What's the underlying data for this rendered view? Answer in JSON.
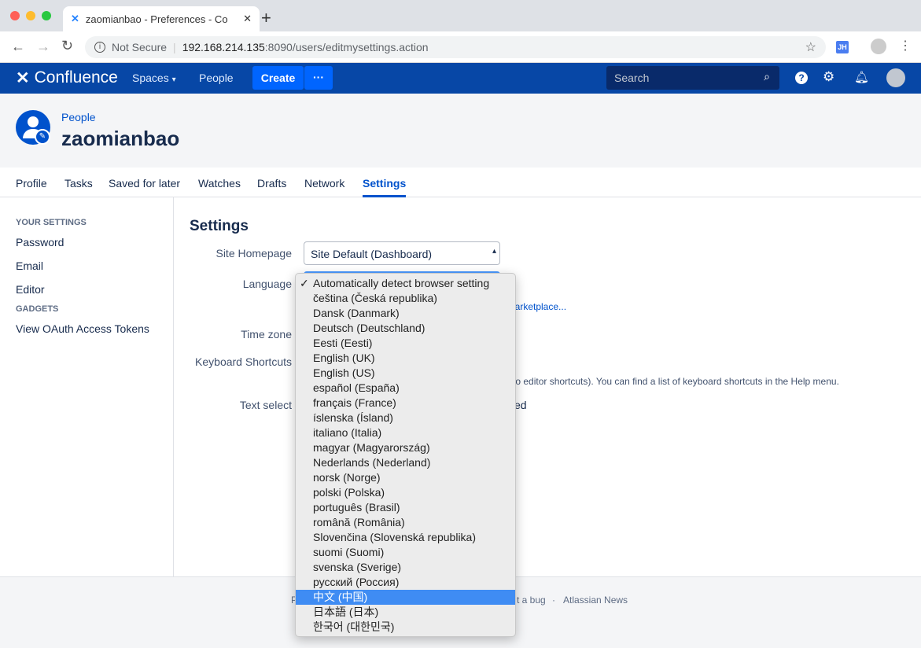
{
  "browser": {
    "tab_title": "zaomianbao - Preferences - Co",
    "security": "Not Secure",
    "url_host": "192.168.214.135",
    "url_rest": ":8090/users/editmysettings.action",
    "ext_badge": "JH"
  },
  "nav": {
    "logo": "Confluence",
    "spaces": "Spaces",
    "people": "People",
    "create": "Create",
    "more": "···",
    "search_placeholder": "Search"
  },
  "header": {
    "breadcrumb": "People",
    "username": "zaomianbao"
  },
  "tabs": [
    "Profile",
    "Tasks",
    "Saved for later",
    "Watches",
    "Drafts",
    "Network",
    "Settings"
  ],
  "active_tab": "Settings",
  "sidebar": {
    "your_settings": "YOUR SETTINGS",
    "items": [
      "Password",
      "Email",
      "Editor"
    ],
    "gadgets": "GADGETS",
    "gadget_items": [
      "View OAuth Access Tokens"
    ]
  },
  "settings": {
    "title": "Settings",
    "site_homepage_label": "Site Homepage",
    "site_homepage_value": "Site Default (Dashboard)",
    "language_label": "Language",
    "time_zone_label": "Time zone",
    "keyboard_label": "Keyboard Shortcuts",
    "text_select_label": "Text select",
    "marketplace_fragment": "larketplace...",
    "keyboard_fragment": "to editor shortcuts). You can find a list of keyboard shortcuts in the Help menu.",
    "text_select_fragment": "ed"
  },
  "language_options": [
    "Automatically detect browser setting",
    "čeština (Česká republika)",
    "Dansk (Danmark)",
    "Deutsch (Deutschland)",
    "Eesti (Eesti)",
    "English (UK)",
    "English (US)",
    "español (España)",
    "français (France)",
    "íslenska (Ísland)",
    "italiano (Italia)",
    "magyar (Magyarország)",
    "Nederlands (Nederland)",
    "norsk (Norge)",
    "polski (Polska)",
    "português (Brasil)",
    "română (România)",
    "Slovenčina (Slovenská republika)",
    "suomi (Suomi)",
    "svenska (Sverige)",
    "русский (Россия)",
    "中文 (中国)",
    "日本語 (日本)",
    "한국어 (대한민국)"
  ],
  "checked_option": "Automatically detect browser setting",
  "highlighted_option": "中文 (中国)",
  "footer": {
    "left_fragment": "P",
    "bug_fragment": "t a bug",
    "sep": "·",
    "news": "Atlassian News"
  },
  "colors": {
    "nav": "#0747a6",
    "create": "#0065ff",
    "link": "#0052cc",
    "highlight": "#3f8cf3"
  }
}
